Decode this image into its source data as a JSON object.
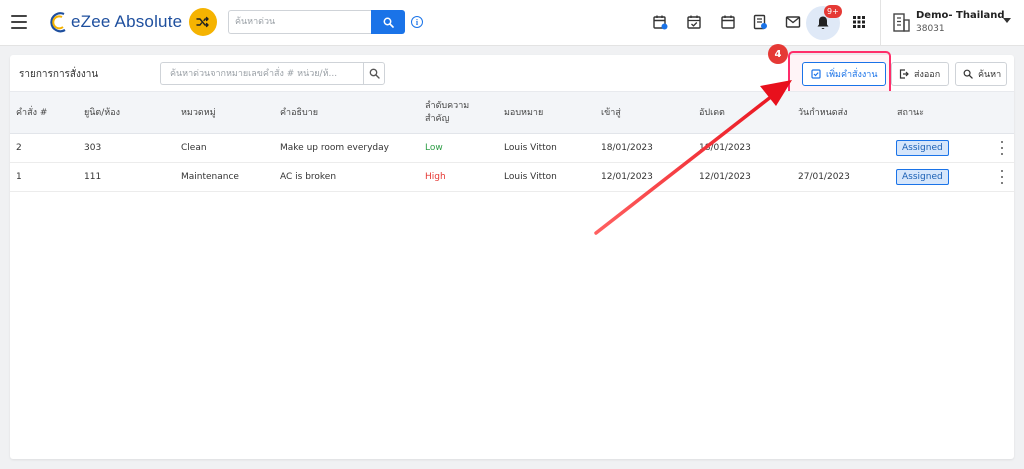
{
  "app": {
    "logo_text": "eZee Absolute",
    "quick_search_placeholder": "ค้นหาด่วน",
    "notification_count": "9+",
    "property": {
      "name": "Demo- Thailand",
      "id": "38031"
    }
  },
  "card": {
    "title": "รายการการสั่งงาน",
    "filter_placeholder": "ค้นหาด่วนจากหมายเลขคำสั่ง # หน่วย/ห้...",
    "step_number": "4",
    "buttons": {
      "add_label": "เพิ่มคำสั่งงาน",
      "export_label": "ส่งออก",
      "search_label": "ค้นหา"
    }
  },
  "table": {
    "headers": {
      "order": "คำสั่ง #",
      "unit": "ยูนิต/ห้อง",
      "category": "หมวดหมู่",
      "description": "คำอธิบาย",
      "priority_line1": "ลำดับความ",
      "priority_line2": "สำคัญ",
      "assignee": "มอบหมาย",
      "checkin": "เข้าสู่",
      "updated": "อัปเดต",
      "due": "วันกำหนดส่ง",
      "status": "สถานะ"
    },
    "rows": [
      {
        "order": "2",
        "unit": "303",
        "category": "Clean",
        "description": "Make up room everyday",
        "priority": "Low",
        "assignee": "Louis Vitton",
        "checkin": "18/01/2023",
        "updated": "18/01/2023",
        "due": "",
        "status": "Assigned"
      },
      {
        "order": "1",
        "unit": "111",
        "category": "Maintenance",
        "description": "AC is broken",
        "priority": "High",
        "assignee": "Louis Vitton",
        "checkin": "12/01/2023",
        "updated": "12/01/2023",
        "due": "27/01/2023",
        "status": "Assigned"
      }
    ]
  },
  "colors": {
    "brand_blue": "#1a73e8",
    "logo_blue": "#1e4f9e",
    "shuffle_yellow": "#f5b301",
    "highlight_pink": "#ff2d6a",
    "arrow_red": "#e8101c",
    "priority_low": "#2e9e47",
    "priority_high": "#e53935"
  },
  "icons": {
    "menu": "hamburger-icon",
    "shuffle": "shuffle-icon",
    "search": "search-icon",
    "info": "info-icon",
    "calendar_badge": "calendar-badge-icon",
    "calendar_check": "calendar-check-icon",
    "calendar": "calendar-icon",
    "report": "report-icon",
    "mail": "mail-icon",
    "bell": "bell-icon",
    "apps": "apps-grid-icon",
    "building": "building-icon",
    "add_task": "checkbox-icon",
    "export": "export-icon"
  }
}
